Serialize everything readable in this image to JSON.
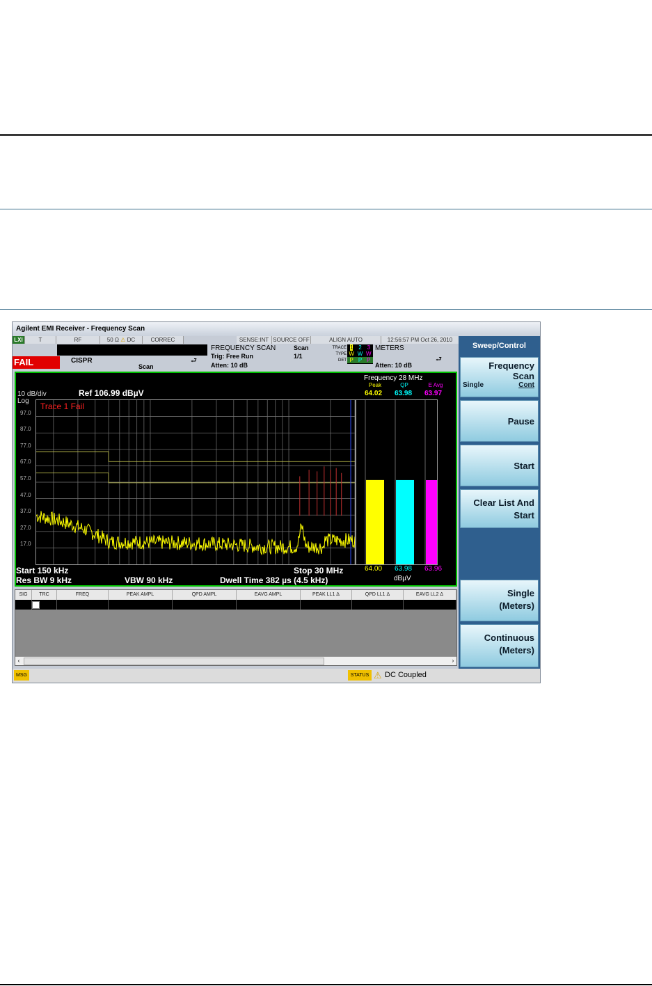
{
  "window_title": "Agilent EMI Receiver  - Frequency Scan",
  "status": {
    "seg1": "LXI",
    "seg2": "T",
    "seg3": "RF",
    "seg4": "50 Ω",
    "seg4b": "DC",
    "seg5": "CORREC",
    "sense": "SENSE:INT",
    "source": "SOURCE OFF",
    "align": "ALIGN AUTO",
    "datetime": "12:56:57 PM Oct 26, 2010",
    "fail": "FAIL",
    "cispr": "CISPR",
    "scan_label": "Scan"
  },
  "measure": {
    "name": "FREQUENCY SCAN",
    "trig": "Trig: Free Run",
    "atten": "Atten: 10 dB",
    "scan": "Scan",
    "scan_count": "1/1",
    "trace_label": "TRACE",
    "type_label": "TYPE",
    "det_label": "DET",
    "trace_nums": [
      "1",
      "2",
      "3"
    ],
    "type_vals": [
      "W",
      "W",
      "W"
    ],
    "det_vals": [
      "P",
      "P",
      "P"
    ],
    "meters": "METERS",
    "meters_atten": "Atten: 10 dB"
  },
  "graph": {
    "scale": "10 dB/div",
    "log": "Log",
    "ref": "Ref 106.99 dBµV",
    "trace_fail": "Trace 1 Fail",
    "yticks": [
      "97.0",
      "87.0",
      "77.0",
      "67.0",
      "57.0",
      "47.0",
      "37.0",
      "27.0",
      "17.0"
    ],
    "start": "Start 150 kHz",
    "stop": "Stop 30 MHz",
    "resbw": "Res BW 9 kHz",
    "vbw": "VBW 90 kHz",
    "dwell": "Dwell Time 382 µs (4.5 kHz)",
    "trace_color": "#ffff00"
  },
  "meters": {
    "freq": "Frequency 28 MHz",
    "labels": [
      "Peak",
      "QP",
      "E Avg"
    ],
    "top_values": [
      "64.02",
      "63.98",
      "63.97"
    ],
    "bottom_values": [
      "64.00",
      "63.98",
      "63.96"
    ],
    "unit": "dBµV",
    "colors": [
      "#ffff00",
      "#00ffff",
      "#ff00ff"
    ],
    "levels": [
      64.0,
      63.98,
      63.96
    ]
  },
  "softkeys": {
    "header": "Sweep/Control",
    "freq_scan_l1": "Frequency",
    "freq_scan_l2": "Scan",
    "freq_scan_single": "Single",
    "freq_scan_cont": "Cont",
    "pause": "Pause",
    "start": "Start",
    "clear_l1": "Clear List And",
    "clear_l2": "Start",
    "single_l1": "Single",
    "single_l2": "(Meters)",
    "cont_l1": "Continuous",
    "cont_l2": "(Meters)"
  },
  "table": {
    "columns": [
      "SIG",
      "TRC",
      "FREQ",
      "PEAK AMPL",
      "QPD AMPL",
      "EAVG AMPL",
      "PEAK LL1 Δ",
      "QPD LL1 Δ",
      "EAVG LL2 Δ"
    ]
  },
  "bottom": {
    "msg": "MSG",
    "status": "STATUS",
    "dc_coupled": "DC Coupled"
  }
}
